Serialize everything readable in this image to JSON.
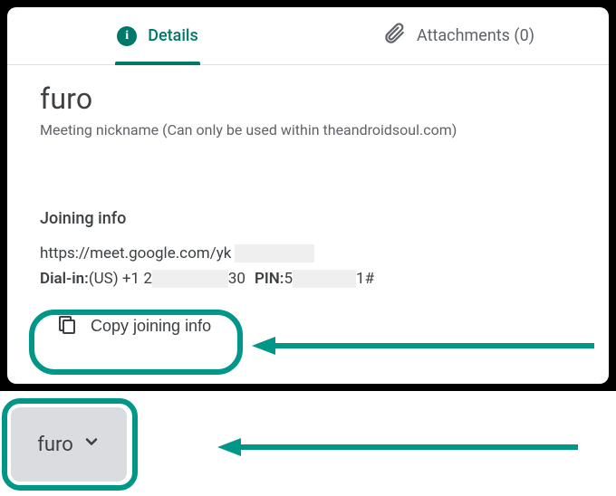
{
  "tabs": {
    "details": "Details",
    "attachments_label": "Attachments (0)"
  },
  "meeting": {
    "name": "furo",
    "subtitle": "Meeting nickname (Can only be used within theandroidsoul.com)"
  },
  "joining": {
    "header": "Joining info",
    "link_prefix": "https://meet.google.com/yk",
    "dial_label": "Dial-in:",
    "dial_prefix": " (US) +1 2",
    "dial_suffix": "30",
    "pin_label": "PIN:",
    "pin_prefix": " 5",
    "pin_suffix": "1#",
    "copy_label": "Copy joining info"
  },
  "bottom": {
    "pill_label": "furo"
  },
  "colors": {
    "accent": "#009688",
    "tab_accent": "#00796b"
  }
}
